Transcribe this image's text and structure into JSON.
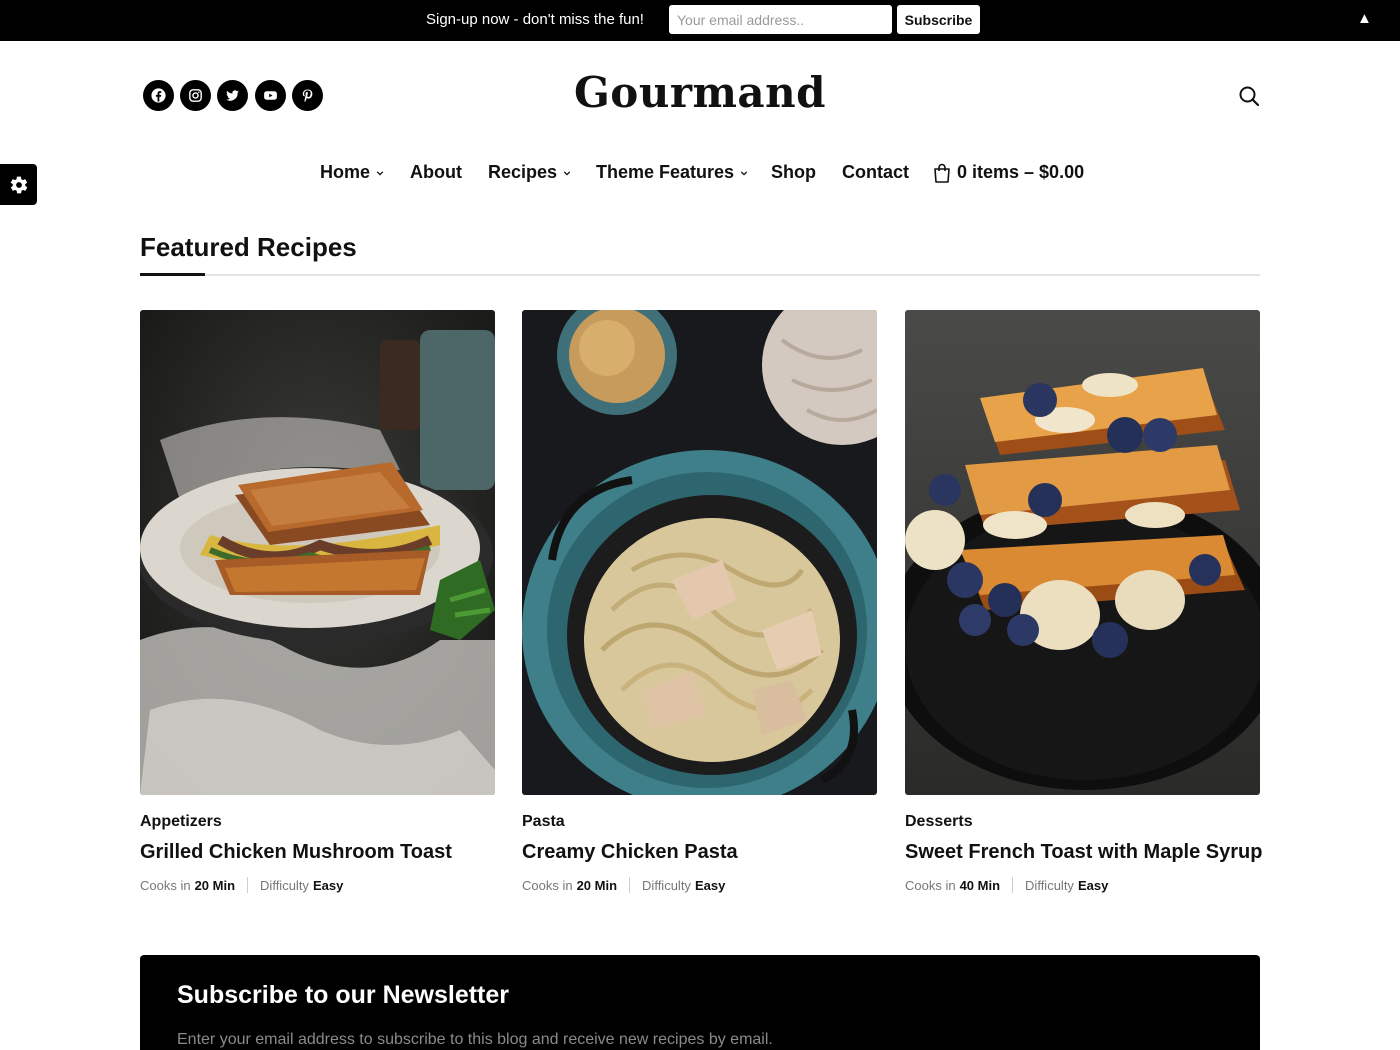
{
  "topbar": {
    "text": "Sign-up now - don't miss the fun!",
    "email_placeholder": "Your email address..",
    "subscribe_label": "Subscribe",
    "toggle_glyph": "▲"
  },
  "header": {
    "logo": "Gourmand",
    "social_icons": [
      "facebook-icon",
      "instagram-icon",
      "twitter-icon",
      "youtube-icon",
      "pinterest-icon"
    ]
  },
  "nav": {
    "items": [
      {
        "label": "Home",
        "has_dropdown": true
      },
      {
        "label": "About",
        "has_dropdown": false
      },
      {
        "label": "Recipes",
        "has_dropdown": true
      },
      {
        "label": "Theme Features",
        "has_dropdown": true
      },
      {
        "label": "Shop",
        "has_dropdown": false
      },
      {
        "label": "Contact",
        "has_dropdown": false
      }
    ],
    "cart_label": "0 items – $0.00"
  },
  "featured": {
    "title": "Featured Recipes",
    "recipes": [
      {
        "category": "Appetizers",
        "title": "Grilled Chicken Mushroom Toast",
        "cooks_label": "Cooks in",
        "time": "20 Min",
        "difficulty_label": "Difficulty",
        "difficulty": "Easy"
      },
      {
        "category": "Pasta",
        "title": "Creamy Chicken Pasta",
        "cooks_label": "Cooks in",
        "time": "20 Min",
        "difficulty_label": "Difficulty",
        "difficulty": "Easy"
      },
      {
        "category": "Desserts",
        "title": "Sweet French Toast with Maple Syrup",
        "cooks_label": "Cooks in",
        "time": "40 Min",
        "difficulty_label": "Difficulty",
        "difficulty": "Easy"
      }
    ]
  },
  "newsletter": {
    "title": "Subscribe to our Newsletter",
    "text": "Enter your email address to subscribe to this blog and receive new recipes by email."
  },
  "colors": {
    "topbar_bg": "#000000",
    "text": "#111111",
    "muted": "#777777",
    "newsletter_bg": "#000000"
  }
}
